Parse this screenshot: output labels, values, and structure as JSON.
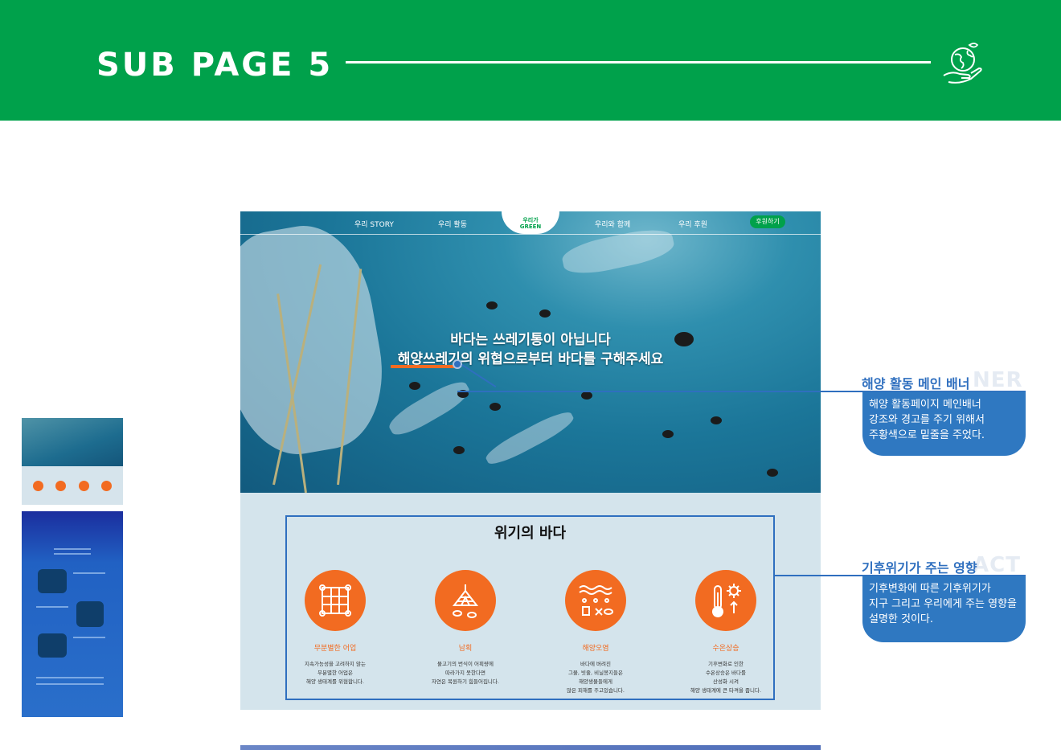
{
  "header": {
    "title": "SUB PAGE 5",
    "icon": "globe-hand-icon"
  },
  "mockup": {
    "nav": {
      "items": [
        "우리 STORY",
        "우리 활동",
        "우리와 함께",
        "우리 후원"
      ],
      "logo_line1": "우리가",
      "logo_line2": "GREEN",
      "donate_label": "후원하기"
    },
    "hero": {
      "line1": "바다는 쓰레기통이 아닙니다",
      "line2": "해양쓰레기의 위협으로부터 바다를 구해주세요"
    },
    "crisis": {
      "title": "위기의 바다",
      "cards": [
        {
          "title": "무분별한 어업",
          "icon": "fishing-net-icon",
          "desc": "지속가능성을 고려하지 않는\n무분별한 어업은\n해양 생태계를 위협합니다."
        },
        {
          "title": "남획",
          "icon": "fish-net-icon",
          "desc": "물고기의 번식이 어획량에\n따라가지 못한다면\n자연은 복원하기 힘들어집니다."
        },
        {
          "title": "해양오염",
          "icon": "ocean-pollution-icon",
          "desc": "바다에 버려진\n그물, 빗줄, 비닐봉지들은\n해양생물들에게\n많은 피해를 주고있습니다."
        },
        {
          "title": "수온상승",
          "icon": "thermometer-icon",
          "desc": "기후변화로 인한\n수온상승은 바다를\n산성화 시켜\n해양 생태계에 큰 타격을 줍니다."
        }
      ]
    }
  },
  "annotations": [
    {
      "title": "해양 활동 메인 배너",
      "ghost": "NER",
      "text": "해양 활동페이지 메인배너\n강조와 경고를 주기 위해서\n주황색으로 밑줄을 주었다."
    },
    {
      "title": "기후위기가 주는 영향",
      "ghost": "ACT",
      "text": "기후변화에 따른 기후위기가\n지구 그리고 우리에게 주는 영향을\n설명한 것이다."
    }
  ],
  "colors": {
    "brand_green": "#00a14b",
    "accent_orange": "#f26b21",
    "annotation_blue": "#2f6fbf"
  }
}
